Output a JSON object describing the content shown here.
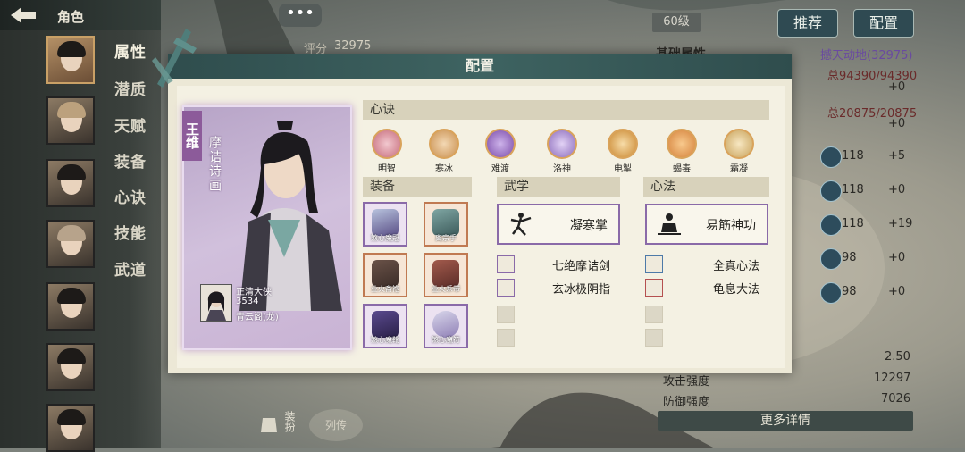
{
  "header": {
    "back_icon": "back-arrow-icon",
    "title": "角色"
  },
  "topbar": {
    "level": "60级",
    "recommend_label": "推荐",
    "config_label": "配置",
    "score_label": "评分",
    "score_value": "32975"
  },
  "sidebar": {
    "tabs": [
      {
        "label": "属性"
      },
      {
        "label": "潜质"
      },
      {
        "label": "天赋"
      },
      {
        "label": "装备"
      },
      {
        "label": "心诀"
      },
      {
        "label": "技能"
      },
      {
        "label": "武道"
      }
    ]
  },
  "right_panel": {
    "basic_attr_label": "基础属性",
    "rank_text": "撼天动地(32975)",
    "rows": [
      {
        "value": "总94390/94390",
        "delta": "+0"
      },
      {
        "value": "总20875/20875",
        "delta": "+0"
      },
      {
        "stat": "118",
        "delta": "+5"
      },
      {
        "stat": "118",
        "delta": "+0"
      },
      {
        "stat": "118",
        "delta": "+19"
      },
      {
        "stat": "98",
        "delta": "+0"
      },
      {
        "stat": "98",
        "delta": "+0"
      }
    ],
    "extra": [
      {
        "label": "",
        "value": "2.50"
      },
      {
        "label": "攻击强度",
        "value": "12297"
      },
      {
        "label": "防御强度",
        "value": "7026"
      }
    ],
    "more_label": "更多详情"
  },
  "bottom": {
    "dress_label": "装扮",
    "bio_label": "列传"
  },
  "dialog": {
    "title": "配置",
    "hero": {
      "name": "王维",
      "title": "摩诘诗画",
      "player_title": "正清大侠",
      "player_power": "3534",
      "player_guild": "青云阁(龙)"
    },
    "xinjue": {
      "section_label": "心诀",
      "items": [
        {
          "label": "明智",
          "color": "#c56a7a"
        },
        {
          "label": "寒冰",
          "color": "#c98f4e"
        },
        {
          "label": "难渡",
          "color": "#7a4aa8"
        },
        {
          "label": "洛神",
          "color": "#8a6aba"
        },
        {
          "label": "电掣",
          "color": "#c9862e"
        },
        {
          "label": "蝎毒",
          "color": "#d4813a"
        },
        {
          "label": "霜凝",
          "color": "#c8a25a"
        }
      ]
    },
    "equipment": {
      "section_label": "装备",
      "items": [
        {
          "label": "煞心魔冠",
          "color": "#8a6aa8"
        },
        {
          "label": "离宗手",
          "color": "#c07a52"
        },
        {
          "label": "业火斋袍",
          "color": "#c07a52"
        },
        {
          "label": "业火系带",
          "color": "#c07a52"
        },
        {
          "label": "煞心魔靴",
          "color": "#8a6aa8"
        },
        {
          "label": "煞心魔符",
          "color": "#8a6aa8"
        }
      ]
    },
    "wuxue": {
      "section_label": "武学",
      "main": "凝寒掌",
      "sub": [
        "七绝摩诘剑",
        "玄冰极阴指"
      ]
    },
    "xinfa": {
      "section_label": "心法",
      "main": "易筋神功",
      "sub": [
        "全真心法",
        "龟息大法"
      ]
    }
  }
}
